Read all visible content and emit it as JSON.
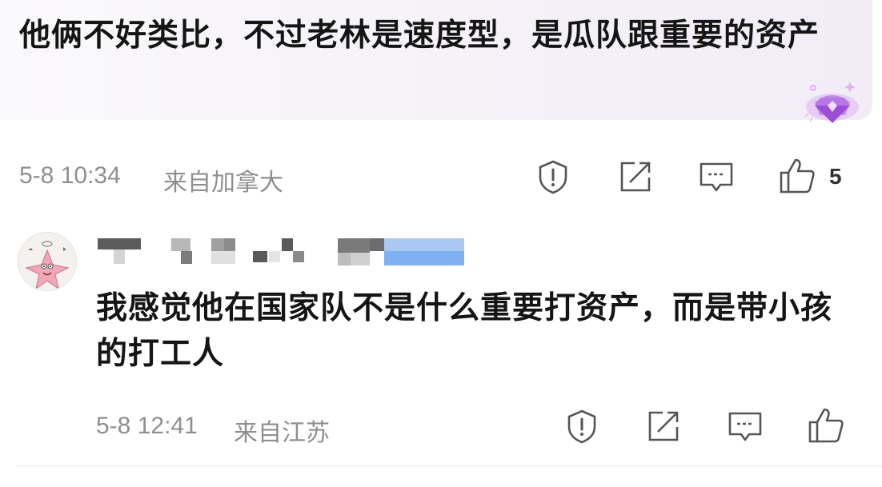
{
  "reply": {
    "text": "他俩不好类比，不过老林是速度型，是瓜队跟重要的资产",
    "timestamp": "5-8 10:34",
    "location": "来自加拿大",
    "like_count": "5",
    "badge_icon": "diamond-badge-icon"
  },
  "comment": {
    "text": "我感觉他在国家队不是什么重要打资产，而是带小孩的打工人",
    "timestamp": "5-8 12:41",
    "location": "来自江苏",
    "avatar_icon": "patrick-star-avatar"
  },
  "icons": [
    "report-icon",
    "share-icon",
    "comment-icon",
    "like-icon"
  ],
  "colors": {
    "meta_text": "#8f8f8f",
    "badge": "#b06ad8",
    "username_blue": "#7fb0f2"
  }
}
